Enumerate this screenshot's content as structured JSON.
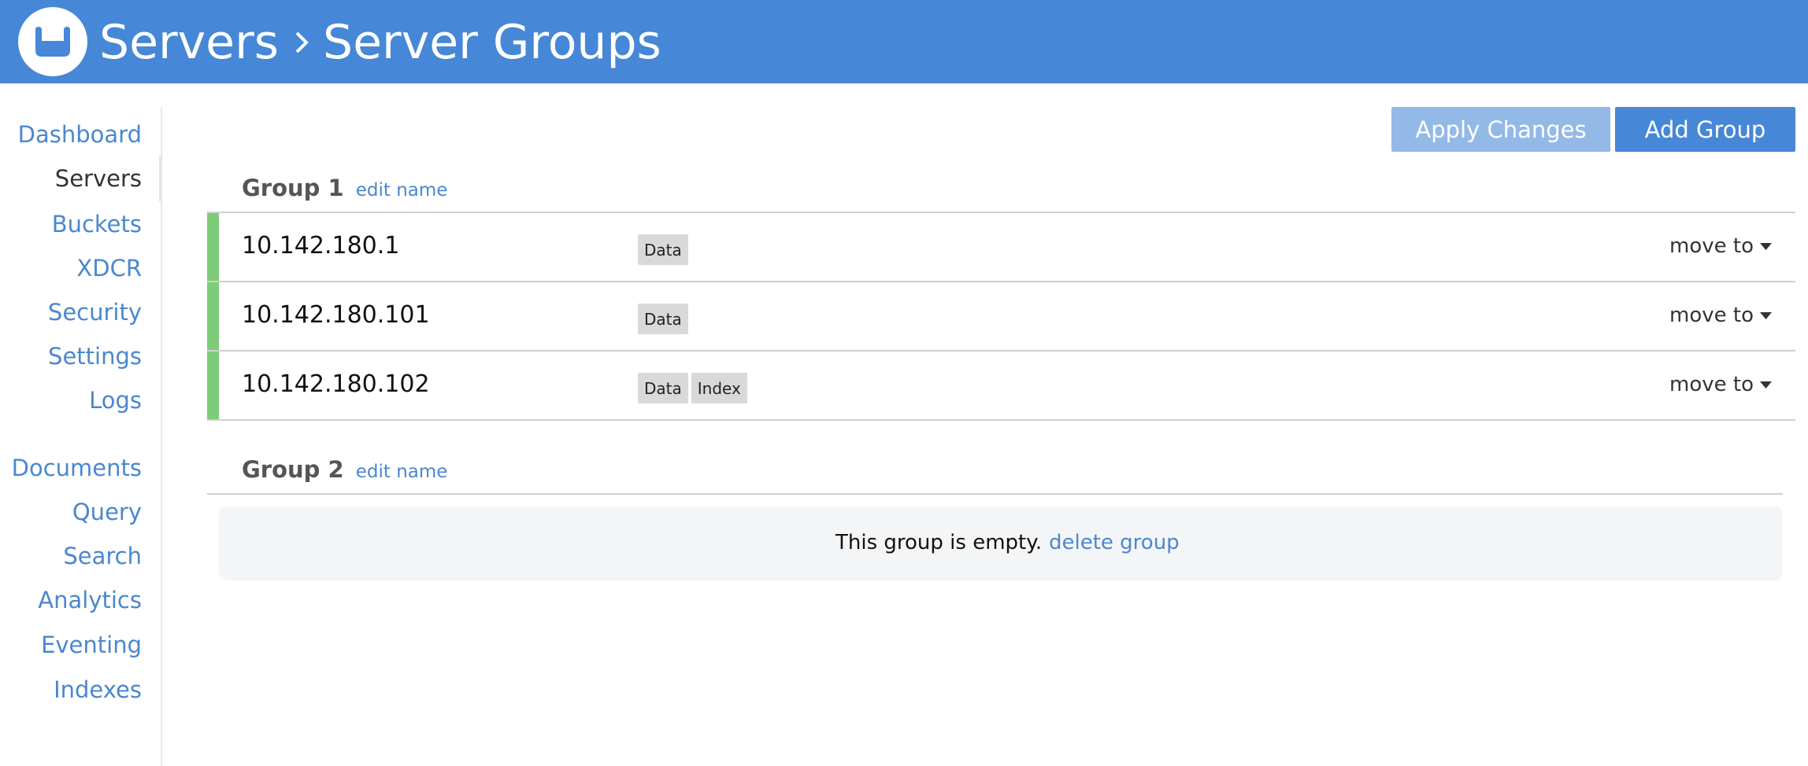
{
  "header": {
    "logo_icon": "couchbase-logo-icon",
    "breadcrumb_parent": "Servers",
    "breadcrumb_separator_icon": "chevron-right-icon",
    "breadcrumb_current": "Server Groups"
  },
  "sidebar": {
    "items": [
      {
        "label": "Dashboard",
        "active": false
      },
      {
        "label": "Servers",
        "active": true
      },
      {
        "label": "Buckets",
        "active": false
      },
      {
        "label": "XDCR",
        "active": false
      },
      {
        "label": "Security",
        "active": false
      },
      {
        "label": "Settings",
        "active": false
      },
      {
        "label": "Logs",
        "active": false
      },
      {
        "label": "Documents",
        "active": false
      },
      {
        "label": "Query",
        "active": false
      },
      {
        "label": "Search",
        "active": false
      },
      {
        "label": "Analytics",
        "active": false
      },
      {
        "label": "Eventing",
        "active": false
      },
      {
        "label": "Indexes",
        "active": false
      }
    ]
  },
  "toolbar": {
    "apply_label": "Apply Changes",
    "add_group_label": "Add Group"
  },
  "groups": [
    {
      "name": "Group 1",
      "edit_label": "edit name",
      "servers": [
        {
          "ip": "10.142.180.1",
          "services": [
            "Data"
          ],
          "move_label": "move to",
          "status": "healthy"
        },
        {
          "ip": "10.142.180.101",
          "services": [
            "Data"
          ],
          "move_label": "move to",
          "status": "healthy"
        },
        {
          "ip": "10.142.180.102",
          "services": [
            "Data",
            "Index"
          ],
          "move_label": "move to",
          "status": "healthy"
        }
      ]
    },
    {
      "name": "Group 2",
      "edit_label": "edit name",
      "empty_message": "This group is empty.",
      "delete_label": "delete group"
    }
  ],
  "colors": {
    "header_bg": "#4687d7",
    "link": "#4a87d0",
    "apply_button_disabled": "#93b9e6",
    "add_button": "#4687d7",
    "status_healthy": "#7ccc78",
    "service_badge_bg": "#d9d9d9",
    "empty_box_bg": "#f4f5f7"
  }
}
